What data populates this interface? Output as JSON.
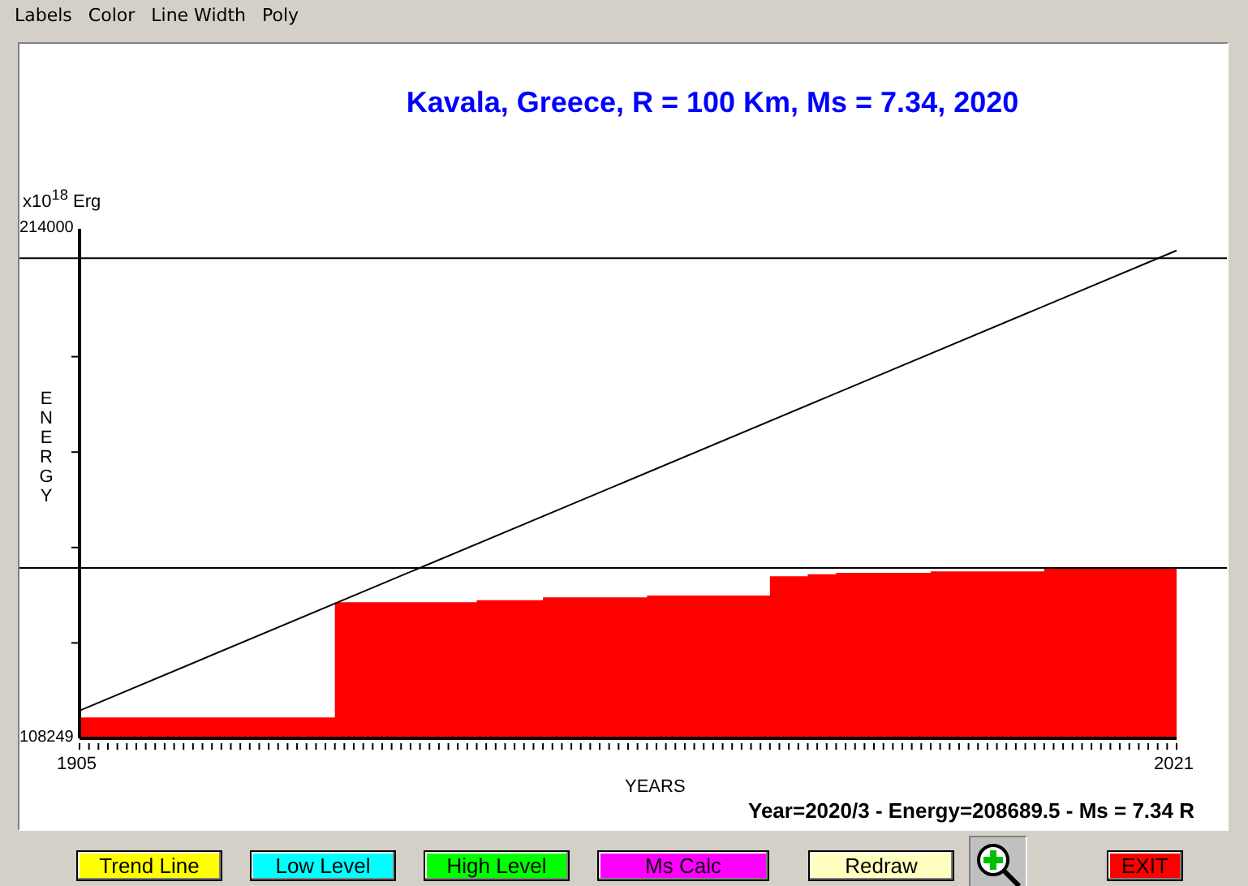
{
  "menu": [
    "Labels",
    "Color",
    "Line Width",
    "Poly"
  ],
  "chart": {
    "title": "Kavala, Greece, R = 100 Km, Ms = 7.34, 2020",
    "unit": "x10$^{18}$ Erg",
    "status": "Year=2020/3 - Energy=208689.5 - Ms = 7.34 R",
    "chart_data": {
      "type": "area",
      "xlabel": "YEARS",
      "ylabel": "ENERGY",
      "x": [
        1905,
        1932,
        1947,
        1954,
        1965,
        1978,
        1982,
        1985,
        1995,
        2007,
        2021
      ],
      "series": [
        {
          "color": "#ff0000",
          "values": [
            112600,
            136500,
            136900,
            137500,
            137900,
            141900,
            142300,
            142600,
            142900,
            143600,
            143600
          ]
        },
        {
          "type": "line",
          "color": "#000000",
          "values": [
            114000,
            null,
            null,
            null,
            null,
            null,
            null,
            null,
            null,
            null,
            209500
          ]
        }
      ],
      "xlim": [
        1905,
        2021
      ],
      "ylim": [
        108249,
        214000
      ],
      "xticks": [
        {
          "value": 1905,
          "label": "1905"
        },
        {
          "value": 2021,
          "label": "2021"
        }
      ],
      "yticks": [
        {
          "value": 108249,
          "label": "108249"
        },
        {
          "value": 214000,
          "label": "214000"
        }
      ],
      "ref_lines": [
        {
          "axis": "y",
          "value": 207900
        },
        {
          "axis": "y",
          "value": 143600
        }
      ]
    }
  },
  "buttons": [
    {
      "label": "Trend Line",
      "color": "#ffff00"
    },
    {
      "label": "Low Level",
      "color": "#00ffff"
    },
    {
      "label": "High Level",
      "color": "#00ff00"
    },
    {
      "label": "Ms Calc",
      "color": "#ff00ff"
    },
    {
      "label": "Redraw",
      "color": "#ffffc0"
    },
    {
      "kind": "zoom"
    },
    {
      "label": "EXIT",
      "color": "#ff0000"
    }
  ]
}
